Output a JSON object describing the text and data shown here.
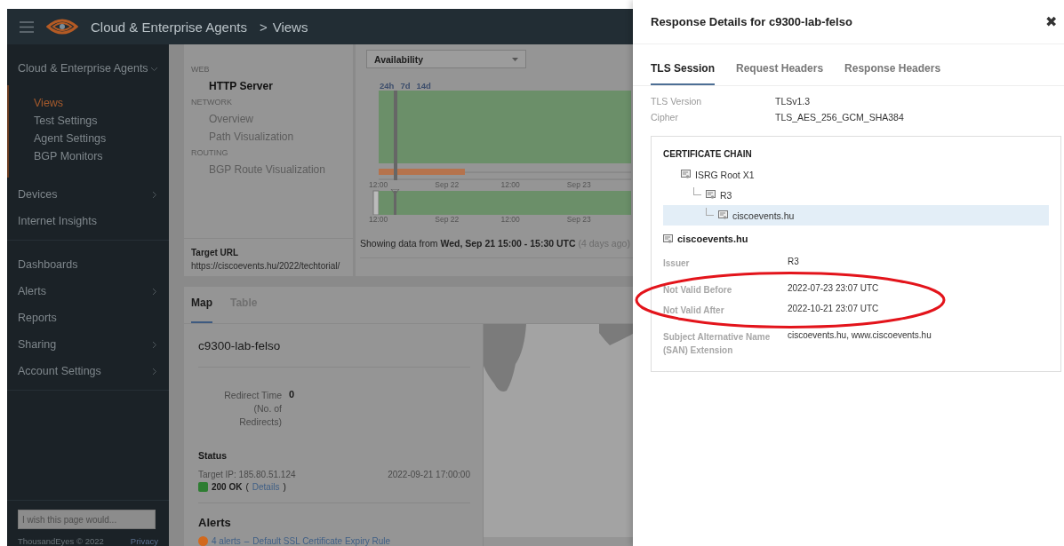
{
  "topbar": {
    "breadcrumb": [
      "Cloud & Enterprise Agents",
      "Views"
    ],
    "separator": ">"
  },
  "sidebar": {
    "sections": [
      [
        {
          "label": "Cloud & Enterprise Agents",
          "selected": false,
          "expanded": true,
          "children": [
            {
              "label": "Views",
              "selected": true
            },
            {
              "label": "Test Settings",
              "selected": false
            },
            {
              "label": "Agent Settings",
              "selected": false
            },
            {
              "label": "BGP Monitors",
              "selected": false
            }
          ]
        },
        {
          "label": "Devices",
          "selected": false,
          "expanded": false
        },
        {
          "label": "Internet Insights",
          "selected": false
        }
      ],
      [
        {
          "label": "Dashboards",
          "selected": false
        },
        {
          "label": "Alerts",
          "selected": false,
          "expanded": false
        },
        {
          "label": "Reports",
          "selected": false
        },
        {
          "label": "Sharing",
          "selected": false,
          "expanded": false
        },
        {
          "label": "Account Settings",
          "selected": false,
          "expanded": false
        }
      ]
    ],
    "feedback": {
      "placeholder": "I wish this page would..."
    },
    "copyright": "ThousandEyes © 2022",
    "privacy": "Privacy"
  },
  "views": {
    "groups": [
      {
        "heading": "WEB",
        "items": [
          {
            "label": "HTTP Server",
            "selected": true
          }
        ]
      },
      {
        "heading": "NETWORK",
        "items": [
          {
            "label": "Overview",
            "selected": false
          },
          {
            "label": "Path Visualization",
            "selected": false
          }
        ]
      },
      {
        "heading": "ROUTING",
        "items": [
          {
            "label": "BGP Route Visualization",
            "selected": false
          }
        ]
      }
    ],
    "target_label": "Target URL",
    "target_url": "https://ciscoevents.hu/2022/techtorial/"
  },
  "timeline": {
    "metric": "Availability",
    "ranges": [
      "24h",
      "7d",
      "14d"
    ],
    "ticks": [
      "12:00",
      "Sep 22",
      "12:00",
      "Sep 23"
    ],
    "overview_ticks": [
      "12:00",
      "Sep 22",
      "12:00",
      "Sep 23"
    ],
    "showing": "Showing data from **Wed, Sep 21 15:00 - 15:30 UTC**",
    "ago": "(4 days ago)"
  },
  "results": {
    "tabs": [
      {
        "label": "Map",
        "selected": true
      },
      {
        "label": "Table",
        "selected": false
      }
    ],
    "agent": "c9300-lab-felso",
    "metric": {
      "label": "Redirect Time (No. of Redirects)",
      "value": "0"
    },
    "status_heading": "Status",
    "target_ip": "Target IP: 185.80.51.124",
    "timestamp": "2022-09-21 17:00:00",
    "status": {
      "code": "200 OK",
      "color": "#2e7d32",
      "open": "(",
      "link": "Details",
      "close": ")"
    },
    "alerts_heading": "Alerts",
    "alert": {
      "count": "4 alerts",
      "separator": "–",
      "rule": "Default SSL Certificate Expiry Rule",
      "color": "#d2691e"
    }
  },
  "panel": {
    "title": "Response Details for c9300-lab-felso",
    "close": "✖",
    "tabs": [
      {
        "label": "TLS Session",
        "selected": true
      },
      {
        "label": "Request Headers",
        "selected": false
      },
      {
        "label": "Response Headers",
        "selected": false
      }
    ],
    "fields": [
      {
        "label": "TLS Version",
        "value": "TLSv1.3"
      },
      {
        "label": "Cipher",
        "value": "TLS_AES_256_GCM_SHA384"
      }
    ],
    "chain_heading": "CERTIFICATE CHAIN",
    "chain": [
      {
        "label": "ISRG Root X1",
        "selected": false,
        "children": [
          {
            "label": "R3",
            "selected": false,
            "children": [
              {
                "label": "ciscoevents.hu",
                "selected": true
              }
            ]
          }
        ]
      }
    ],
    "cert_name": "ciscoevents.hu",
    "cert_fields": [
      {
        "label": "Issuer",
        "value": "R3",
        "circled": false
      },
      {
        "label": "Not Valid Before",
        "value": "2022-07-23 23:07 UTC",
        "circled": true
      },
      {
        "label": "Not Valid After",
        "value": "2022-10-21 23:07 UTC",
        "circled": true
      },
      {
        "label": "Subject Alternative Name (SAN) Extension",
        "value": "ciscoevents.hu, www.ciscoevents.hu",
        "circled": false
      }
    ]
  }
}
